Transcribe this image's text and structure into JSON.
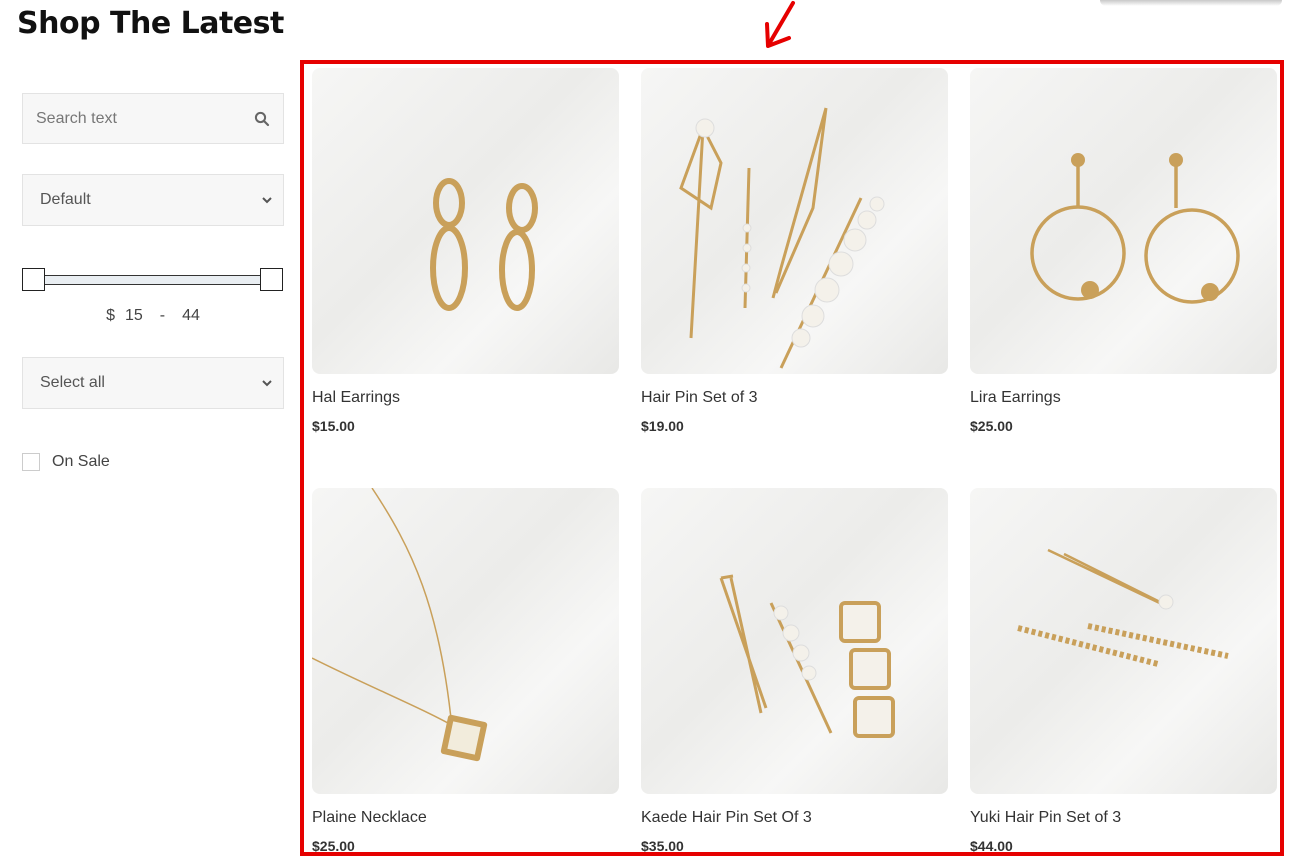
{
  "page": {
    "title": "Shop The Latest"
  },
  "sidebar": {
    "search": {
      "placeholder": "Search text"
    },
    "sort": {
      "selected": "Default"
    },
    "price_range": {
      "currency": "$",
      "min": "15",
      "separator": "-",
      "max": "44"
    },
    "category": {
      "selected": "Select all"
    },
    "on_sale": {
      "label": "On Sale",
      "checked": false
    }
  },
  "products": [
    {
      "name": "Hal Earrings",
      "price": "$15.00"
    },
    {
      "name": "Hair Pin Set of 3",
      "price": "$19.00"
    },
    {
      "name": "Lira Earrings",
      "price": "$25.00"
    },
    {
      "name": "Plaine Necklace",
      "price": "$25.00"
    },
    {
      "name": "Kaede Hair Pin Set Of 3",
      "price": "$35.00"
    },
    {
      "name": "Yuki Hair Pin Set of 3",
      "price": "$44.00"
    }
  ],
  "colors": {
    "highlight": "#e60000",
    "gold": "#c9a05a",
    "pearl": "#f4f1ea"
  },
  "icons": {
    "search": "search-icon",
    "dropdown": "chevron-down-icon"
  }
}
